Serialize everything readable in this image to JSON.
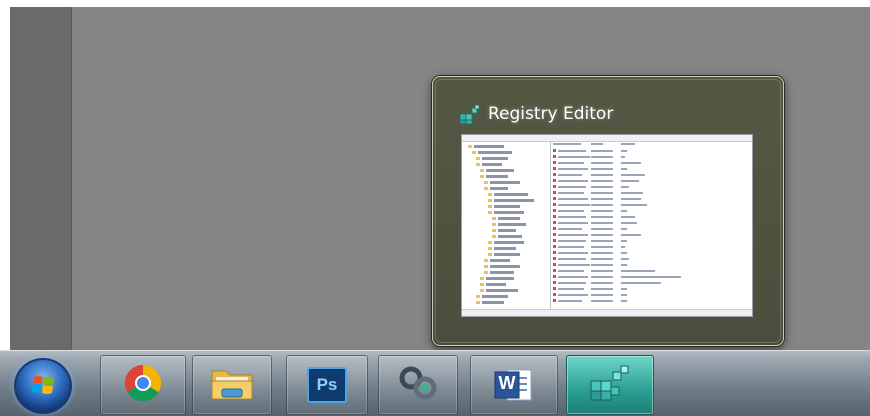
{
  "desktop": {},
  "thumbnail": {
    "title": "Registry Editor",
    "icon": "registry-editor-icon"
  },
  "taskbar": {
    "start": {
      "icon": "windows-start-orb-icon"
    },
    "buttons": [
      {
        "app": "chrome",
        "icon": "chrome-icon",
        "active": false
      },
      {
        "app": "windows-explorer",
        "icon": "folder-icon",
        "active": false
      },
      {
        "app": "photoshop",
        "icon": "photoshop-icon",
        "label": "Ps",
        "active": false
      },
      {
        "app": "connection",
        "icon": "linked-rings-icon",
        "active": false
      },
      {
        "app": "word",
        "icon": "word-icon",
        "label": "W",
        "active": false
      },
      {
        "app": "registry-editor",
        "icon": "registry-editor-icon",
        "active": true
      }
    ]
  }
}
